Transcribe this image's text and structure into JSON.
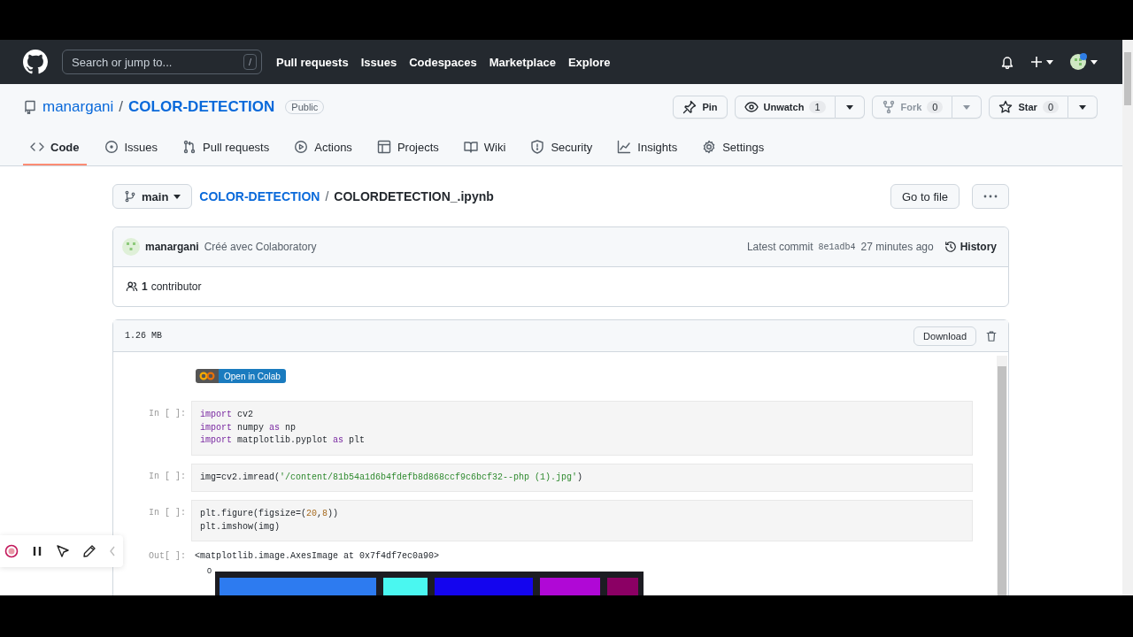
{
  "global_nav": {
    "search_placeholder": "Search or jump to...",
    "search_key": "/",
    "links": [
      "Pull requests",
      "Issues",
      "Codespaces",
      "Marketplace",
      "Explore"
    ]
  },
  "repo": {
    "owner": "manargani",
    "separator": "/",
    "name": "COLOR-DETECTION",
    "visibility": "Public",
    "actions": [
      {
        "kind": "pin",
        "label": "Pin",
        "disabled": false
      },
      {
        "kind": "watch",
        "label": "Unwatch",
        "count": "1",
        "disabled": false
      },
      {
        "kind": "fork",
        "label": "Fork",
        "count": "0",
        "disabled": true
      },
      {
        "kind": "star",
        "label": "Star",
        "count": "0",
        "disabled": false
      }
    ]
  },
  "tabs": [
    {
      "label": "Code",
      "selected": true
    },
    {
      "label": "Issues",
      "selected": false
    },
    {
      "label": "Pull requests",
      "selected": false
    },
    {
      "label": "Actions",
      "selected": false
    },
    {
      "label": "Projects",
      "selected": false
    },
    {
      "label": "Wiki",
      "selected": false
    },
    {
      "label": "Security",
      "selected": false
    },
    {
      "label": "Insights",
      "selected": false
    },
    {
      "label": "Settings",
      "selected": false
    }
  ],
  "breadcrumb": {
    "branch": "main",
    "repo": "COLOR-DETECTION",
    "separator": "/",
    "file": "COLORDETECTION_.ipynb"
  },
  "go_to_file": "Go to file",
  "commit": {
    "author": "manargani",
    "message": "Créé avec Colaboratory",
    "prefix": "Latest commit",
    "sha": "8e1adb4",
    "time": "27 minutes ago",
    "history": "History"
  },
  "contributors": {
    "count": "1",
    "label": "contributor"
  },
  "file": {
    "size": "1.26 MB",
    "download": "Download"
  },
  "notebook": {
    "badge": "Open in Colab",
    "cells": [
      {
        "kind": "input",
        "prompt": "In [ ]:",
        "lines": [
          [
            {
              "t": "import",
              "kind": "kw"
            },
            {
              "t": " cv2",
              "kind": "plain"
            }
          ],
          [
            {
              "t": "import",
              "kind": "kw"
            },
            {
              "t": " numpy ",
              "kind": "plain"
            },
            {
              "t": "as",
              "kind": "kw"
            },
            {
              "t": " np",
              "kind": "plain"
            }
          ],
          [
            {
              "t": "import",
              "kind": "kw"
            },
            {
              "t": " matplotlib.pyplot ",
              "kind": "plain"
            },
            {
              "t": "as",
              "kind": "kw"
            },
            {
              "t": " plt",
              "kind": "plain"
            }
          ]
        ]
      },
      {
        "kind": "input",
        "prompt": "In [ ]:",
        "lines": [
          [
            {
              "t": "img=cv2.imread(",
              "kind": "plain"
            },
            {
              "t": "'/content/81b54a1d6b4fdefb8d868ccf9c6bcf32--php (1).jpg'",
              "kind": "str"
            },
            {
              "t": ")",
              "kind": "plain"
            }
          ]
        ]
      },
      {
        "kind": "input",
        "prompt": "In [ ]:",
        "lines": [
          [
            {
              "t": "plt.figure(figsize=(",
              "kind": "plain"
            },
            {
              "t": "20",
              "kind": "num"
            },
            {
              "t": ",",
              "kind": "plain"
            },
            {
              "t": "8",
              "kind": "num"
            },
            {
              "t": "))",
              "kind": "plain"
            }
          ],
          [
            {
              "t": "plt.imshow(img)",
              "kind": "plain"
            }
          ]
        ]
      },
      {
        "kind": "output",
        "prompt": "Out[ ]:",
        "text": "<matplotlib.image.AxesImage at 0x7f4df7ec0a90>"
      },
      {
        "ytick": "0"
      }
    ]
  }
}
